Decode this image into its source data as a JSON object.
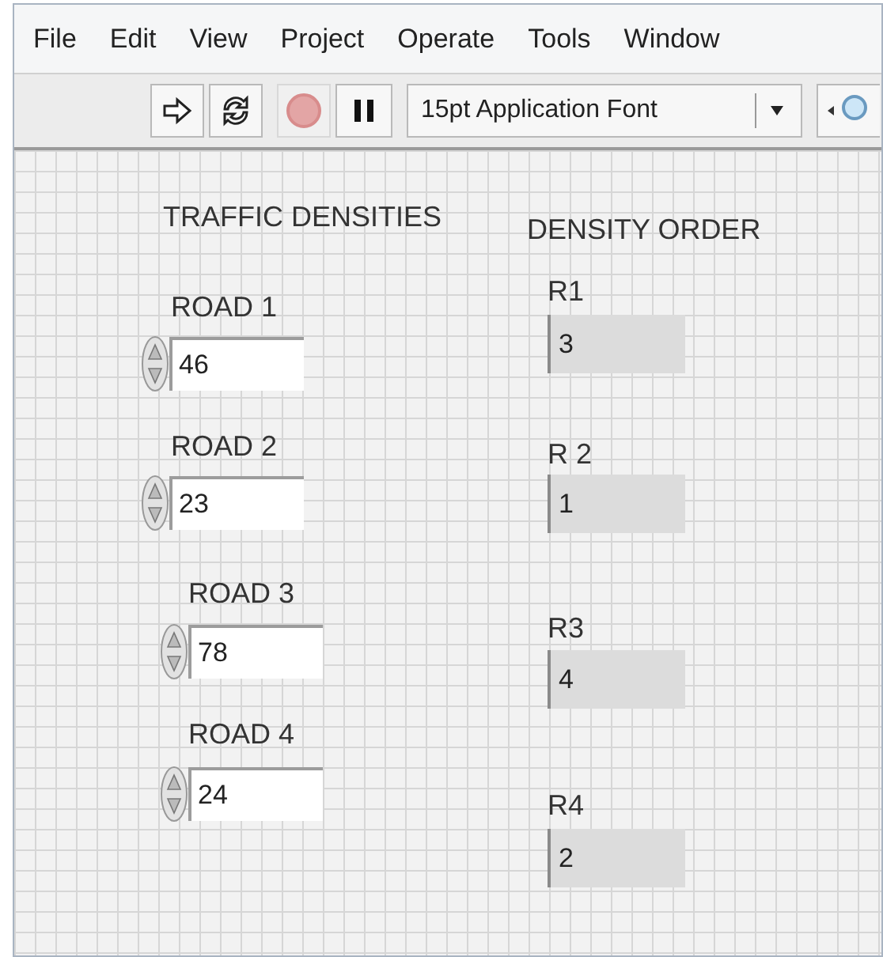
{
  "menu": [
    "File",
    "Edit",
    "View",
    "Project",
    "Operate",
    "Tools",
    "Window"
  ],
  "toolbar": {
    "abort_disabled": true,
    "font": "15pt Application Font"
  },
  "panel": {
    "controls_title": "TRAFFIC DENSITIES",
    "indicators_title": "DENSITY ORDER",
    "controls": [
      {
        "label": "ROAD 1",
        "value": "46"
      },
      {
        "label": "ROAD 2",
        "value": "23"
      },
      {
        "label": "ROAD 3",
        "value": "78"
      },
      {
        "label": "ROAD 4",
        "value": "24"
      }
    ],
    "indicators": [
      {
        "label": "R1",
        "value": "3"
      },
      {
        "label": "R 2",
        "value": "1"
      },
      {
        "label": "R3",
        "value": "4"
      },
      {
        "label": "R4",
        "value": "2"
      }
    ]
  }
}
